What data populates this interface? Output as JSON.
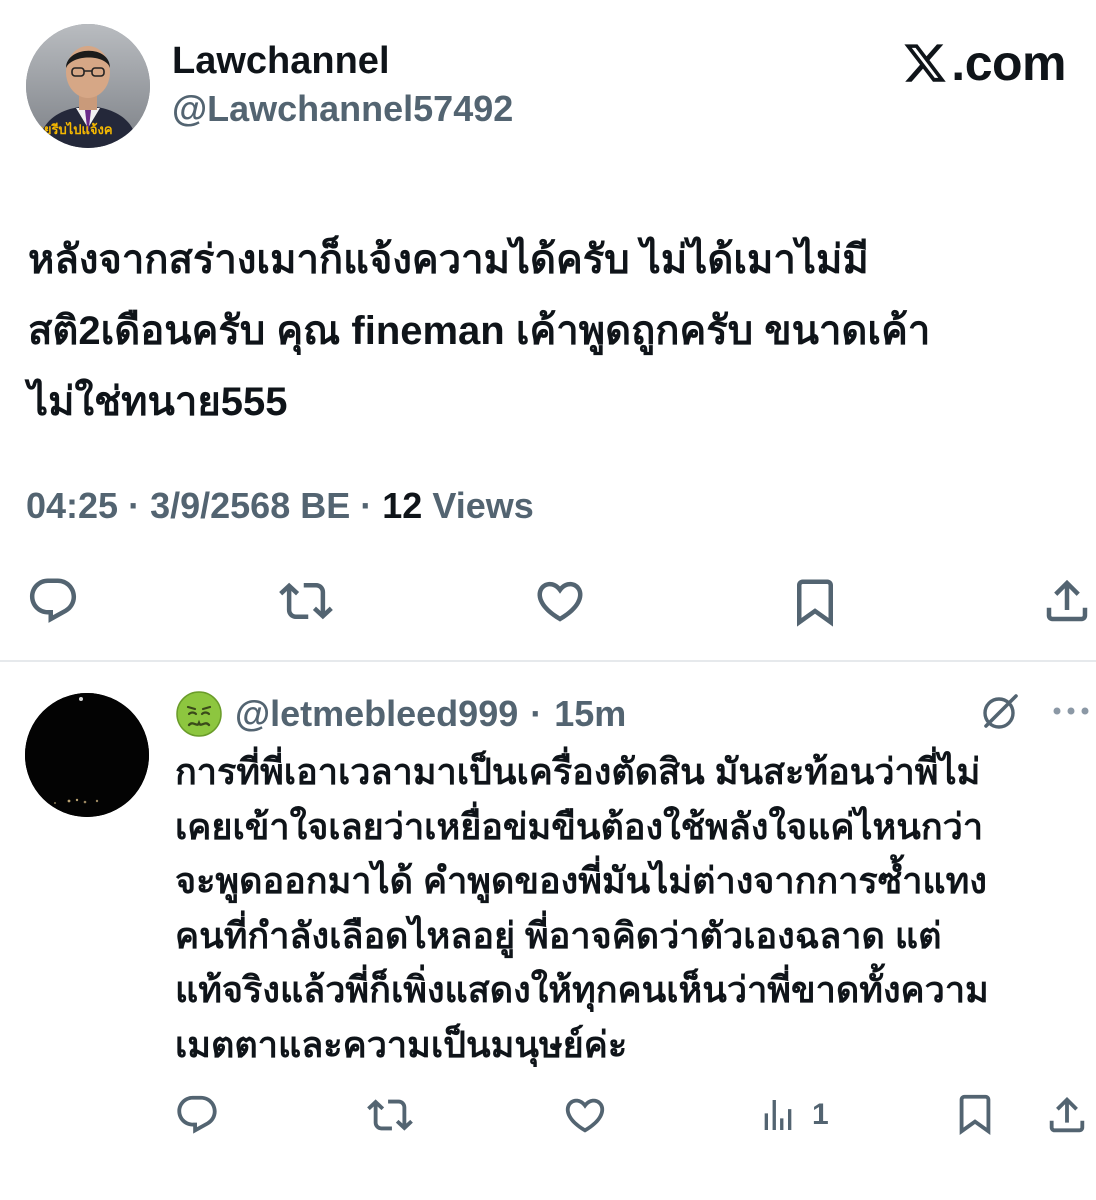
{
  "main_tweet": {
    "display_name": "Lawchannel",
    "handle": "@Lawchannel57492",
    "avatar_caption": "หายรีบไปแจ้งค",
    "text_lines": [
      "หลังจากสร่างเมาก็แจ้งความได้ครับ ไม่ได้เมาไม่มี",
      "สติ2เดือนครับ  คุณ fineman เค้าพูดถูกครับ ขนาดเค้า",
      "ไม่ใช่ทนาย555"
    ],
    "time": "04:25",
    "date": "3/9/2568 BE",
    "views_count": "12",
    "views_label": "Views"
  },
  "branding": {
    "domain": ".com"
  },
  "reply": {
    "handle": "@letmebleed999",
    "time": "15m",
    "text_lines": [
      "การที่พี่เอาเวลามาเป็นเครื่องตัดสิน มันสะท้อนว่าพี่ไม่",
      "เคยเข้าใจเลยว่าเหยื่อข่มขืนต้องใช้พลังใจแค่ไหนกว่า",
      "จะพูดออกมาได้ คำพูดของพี่มันไม่ต่างจากการซ้ำแทง",
      "คนที่กำลังเลือดไหลอยู่ พี่อาจคิดว่าตัวเองฉลาด แต่",
      "แท้จริงแล้วพี่ก็เพิ่งแสดงให้ทุกคนเห็นว่าพี่ขาดทั้งความ",
      "เมตตาและความเป็นมนุษย์ค่ะ"
    ],
    "views_count": "1"
  },
  "colors": {
    "text": "#0f1419",
    "secondary": "#536471",
    "divider": "#e6e9ec"
  }
}
